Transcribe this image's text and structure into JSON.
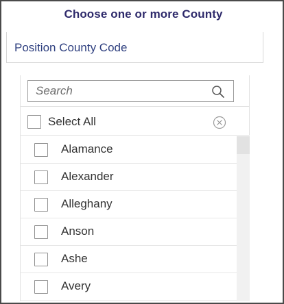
{
  "header": {
    "title": "Choose one or more County"
  },
  "field": {
    "label": "Position County Code"
  },
  "search": {
    "placeholder": "Search",
    "value": ""
  },
  "select_all": {
    "label": "Select All",
    "checked": false
  },
  "list": {
    "items": [
      {
        "label": "Alamance",
        "checked": false
      },
      {
        "label": "Alexander",
        "checked": false
      },
      {
        "label": "Alleghany",
        "checked": false
      },
      {
        "label": "Anson",
        "checked": false
      },
      {
        "label": "Ashe",
        "checked": false
      },
      {
        "label": "Avery",
        "checked": false
      }
    ]
  },
  "icons": {
    "search": "search-icon",
    "clear": "close-circle-icon",
    "checkbox": "checkbox-unchecked-icon"
  },
  "colors": {
    "title": "#2e2a6b",
    "field_label": "#2e3f7f",
    "text": "#333333",
    "border": "#d6d6d6"
  }
}
